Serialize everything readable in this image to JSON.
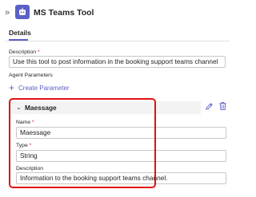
{
  "header": {
    "collapse_icon": "double-chevron-right-icon",
    "app_icon": "bot-icon",
    "title": "MS Teams Tool"
  },
  "tabs": [
    {
      "label": "Details",
      "active": true
    }
  ],
  "form": {
    "description_label": "Description",
    "description_required": "*",
    "description_value": "Use this tool to post information in the booking support teams channel",
    "agent_parameters_label": "Agent Parameters",
    "create_parameter_label": "Create Parameter",
    "create_parameter_icon": "plus-icon"
  },
  "parameter": {
    "header_name": "Maessage",
    "expand_icon": "chevron-down-icon",
    "edit_icon": "pencil-icon",
    "delete_icon": "trash-icon",
    "name_label": "Name",
    "name_required": "*",
    "name_value": "Maessage",
    "type_label": "Type",
    "type_required": "*",
    "type_value": "String",
    "description_label": "Description",
    "description_value": "Information to the booking support teams channel."
  },
  "colors": {
    "accent": "#5b5fc7",
    "highlight": "#e01010",
    "required": "#c50f1f"
  }
}
